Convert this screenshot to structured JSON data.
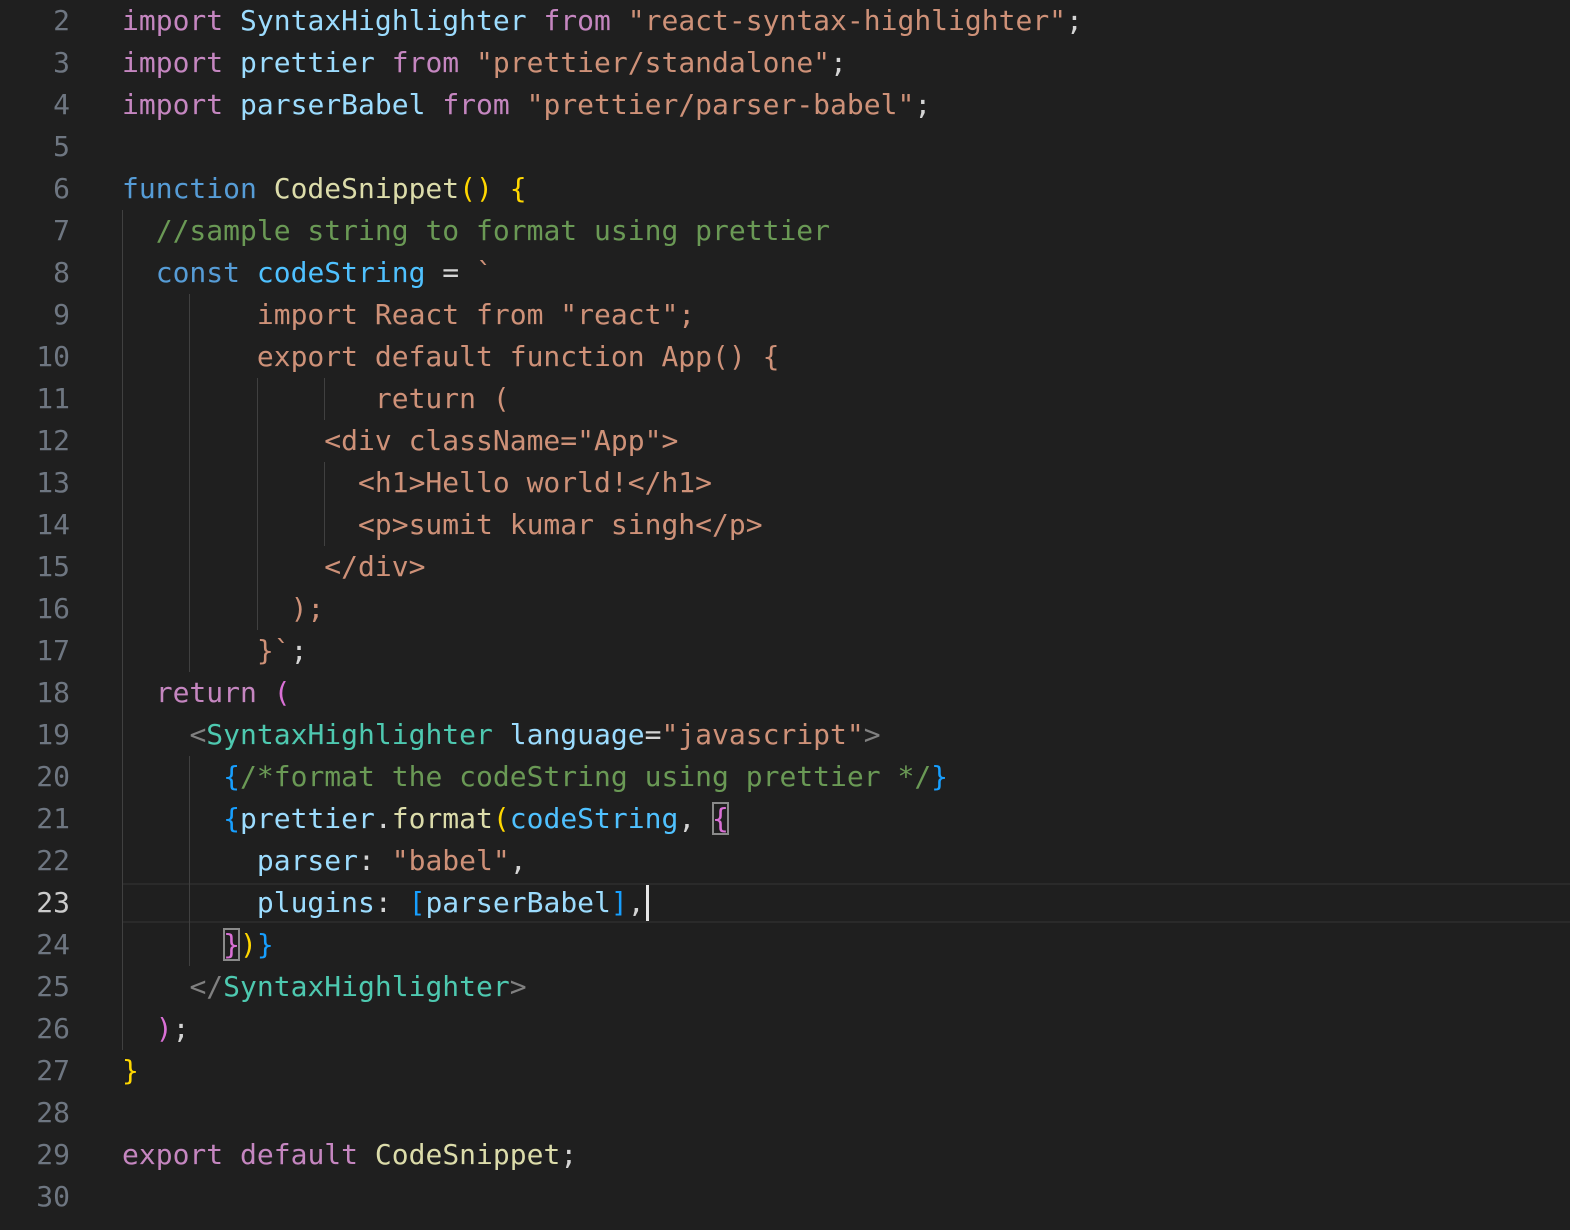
{
  "editor": {
    "language": "javascript",
    "current_line": 23,
    "colors": {
      "background": "#1f1f1f",
      "keyword_control": "#c586c0",
      "keyword_storage": "#569cd6",
      "variable": "#9cdcfe",
      "function": "#dcdcaa",
      "string": "#ce9178",
      "comment": "#6a9955",
      "component": "#4ec9b0",
      "punctuation": "#d4d4d4",
      "bracket_gold": "#ffd700",
      "bracket_pink": "#da70d6",
      "bracket_blue": "#179fff",
      "tag_bracket": "#808080",
      "line_number": "#6e7681"
    },
    "lines": [
      {
        "n": "2",
        "tokens": [
          {
            "t": "import",
            "c": "#c586c0"
          },
          {
            "t": " ",
            "c": "#d4d4d4"
          },
          {
            "t": "SyntaxHighlighter",
            "c": "#9cdcfe"
          },
          {
            "t": " ",
            "c": "#d4d4d4"
          },
          {
            "t": "from",
            "c": "#c586c0"
          },
          {
            "t": " ",
            "c": "#d4d4d4"
          },
          {
            "t": "\"react-syntax-highlighter\"",
            "c": "#ce9178"
          },
          {
            "t": ";",
            "c": "#d4d4d4"
          }
        ]
      },
      {
        "n": "3",
        "tokens": [
          {
            "t": "import",
            "c": "#c586c0"
          },
          {
            "t": " ",
            "c": "#d4d4d4"
          },
          {
            "t": "prettier",
            "c": "#9cdcfe"
          },
          {
            "t": " ",
            "c": "#d4d4d4"
          },
          {
            "t": "from",
            "c": "#c586c0"
          },
          {
            "t": " ",
            "c": "#d4d4d4"
          },
          {
            "t": "\"prettier/standalone\"",
            "c": "#ce9178"
          },
          {
            "t": ";",
            "c": "#d4d4d4"
          }
        ]
      },
      {
        "n": "4",
        "tokens": [
          {
            "t": "import",
            "c": "#c586c0"
          },
          {
            "t": " ",
            "c": "#d4d4d4"
          },
          {
            "t": "parserBabel",
            "c": "#9cdcfe"
          },
          {
            "t": " ",
            "c": "#d4d4d4"
          },
          {
            "t": "from",
            "c": "#c586c0"
          },
          {
            "t": " ",
            "c": "#d4d4d4"
          },
          {
            "t": "\"prettier/parser-babel\"",
            "c": "#ce9178"
          },
          {
            "t": ";",
            "c": "#d4d4d4"
          }
        ]
      },
      {
        "n": "5",
        "tokens": []
      },
      {
        "n": "6",
        "tokens": [
          {
            "t": "function",
            "c": "#569cd6"
          },
          {
            "t": " ",
            "c": "#d4d4d4"
          },
          {
            "t": "CodeSnippet",
            "c": "#dcdcaa"
          },
          {
            "t": "()",
            "c": "#ffd700"
          },
          {
            "t": " ",
            "c": "#d4d4d4"
          },
          {
            "t": "{",
            "c": "#ffd700"
          }
        ]
      },
      {
        "n": "7",
        "tokens": [
          {
            "t": "  ",
            "c": "#d4d4d4"
          },
          {
            "t": "//sample string to format using prettier",
            "c": "#6a9955"
          }
        ]
      },
      {
        "n": "8",
        "tokens": [
          {
            "t": "  ",
            "c": "#d4d4d4"
          },
          {
            "t": "const",
            "c": "#569cd6"
          },
          {
            "t": " ",
            "c": "#d4d4d4"
          },
          {
            "t": "codeString",
            "c": "#4fc1ff"
          },
          {
            "t": " = ",
            "c": "#d4d4d4"
          },
          {
            "t": "`",
            "c": "#ce9178"
          }
        ]
      },
      {
        "n": "9",
        "tokens": [
          {
            "t": "        import React from \"react\";",
            "c": "#ce9178"
          }
        ]
      },
      {
        "n": "10",
        "tokens": [
          {
            "t": "        export default function App() {",
            "c": "#ce9178"
          }
        ]
      },
      {
        "n": "11",
        "tokens": [
          {
            "t": "               return (",
            "c": "#ce9178"
          }
        ]
      },
      {
        "n": "12",
        "tokens": [
          {
            "t": "            <div className=\"App\">",
            "c": "#ce9178"
          }
        ]
      },
      {
        "n": "13",
        "tokens": [
          {
            "t": "              <h1>Hello world!</h1>",
            "c": "#ce9178"
          }
        ]
      },
      {
        "n": "14",
        "tokens": [
          {
            "t": "              <p>sumit kumar singh</p>",
            "c": "#ce9178"
          }
        ]
      },
      {
        "n": "15",
        "tokens": [
          {
            "t": "            </div>",
            "c": "#ce9178"
          }
        ]
      },
      {
        "n": "16",
        "tokens": [
          {
            "t": "          );",
            "c": "#ce9178"
          }
        ]
      },
      {
        "n": "17",
        "tokens": [
          {
            "t": "        }`",
            "c": "#ce9178"
          },
          {
            "t": ";",
            "c": "#d4d4d4"
          }
        ]
      },
      {
        "n": "18",
        "tokens": [
          {
            "t": "  ",
            "c": "#d4d4d4"
          },
          {
            "t": "return",
            "c": "#c586c0"
          },
          {
            "t": " ",
            "c": "#d4d4d4"
          },
          {
            "t": "(",
            "c": "#da70d6"
          }
        ]
      },
      {
        "n": "19",
        "tokens": [
          {
            "t": "    ",
            "c": "#d4d4d4"
          },
          {
            "t": "<",
            "c": "#808080"
          },
          {
            "t": "SyntaxHighlighter",
            "c": "#4ec9b0"
          },
          {
            "t": " ",
            "c": "#d4d4d4"
          },
          {
            "t": "language",
            "c": "#9cdcfe"
          },
          {
            "t": "=",
            "c": "#d4d4d4"
          },
          {
            "t": "\"javascript\"",
            "c": "#ce9178"
          },
          {
            "t": ">",
            "c": "#808080"
          }
        ]
      },
      {
        "n": "20",
        "tokens": [
          {
            "t": "      ",
            "c": "#d4d4d4"
          },
          {
            "t": "{",
            "c": "#179fff"
          },
          {
            "t": "/*format the codeString using prettier */",
            "c": "#6a9955"
          },
          {
            "t": "}",
            "c": "#179fff"
          }
        ]
      },
      {
        "n": "21",
        "tokens": [
          {
            "t": "      ",
            "c": "#d4d4d4"
          },
          {
            "t": "{",
            "c": "#179fff"
          },
          {
            "t": "prettier",
            "c": "#9cdcfe"
          },
          {
            "t": ".",
            "c": "#d4d4d4"
          },
          {
            "t": "format",
            "c": "#dcdcaa"
          },
          {
            "t": "(",
            "c": "#ffd700"
          },
          {
            "t": "codeString",
            "c": "#4fc1ff"
          },
          {
            "t": ", ",
            "c": "#d4d4d4"
          },
          {
            "t": "{",
            "c": "#da70d6",
            "box": true
          }
        ]
      },
      {
        "n": "22",
        "tokens": [
          {
            "t": "        ",
            "c": "#d4d4d4"
          },
          {
            "t": "parser",
            "c": "#9cdcfe"
          },
          {
            "t": ": ",
            "c": "#d4d4d4"
          },
          {
            "t": "\"babel\"",
            "c": "#ce9178"
          },
          {
            "t": ",",
            "c": "#d4d4d4"
          }
        ]
      },
      {
        "n": "23",
        "tokens": [
          {
            "t": "        ",
            "c": "#d4d4d4"
          },
          {
            "t": "plugins",
            "c": "#9cdcfe"
          },
          {
            "t": ": ",
            "c": "#d4d4d4"
          },
          {
            "t": "[",
            "c": "#179fff"
          },
          {
            "t": "parserBabel",
            "c": "#9cdcfe"
          },
          {
            "t": "]",
            "c": "#179fff"
          },
          {
            "t": ",",
            "c": "#d4d4d4"
          }
        ]
      },
      {
        "n": "24",
        "tokens": [
          {
            "t": "      ",
            "c": "#d4d4d4"
          },
          {
            "t": "}",
            "c": "#da70d6",
            "box": true
          },
          {
            "t": ")",
            "c": "#ffd700"
          },
          {
            "t": "}",
            "c": "#179fff"
          }
        ]
      },
      {
        "n": "25",
        "tokens": [
          {
            "t": "    ",
            "c": "#d4d4d4"
          },
          {
            "t": "</",
            "c": "#808080"
          },
          {
            "t": "SyntaxHighlighter",
            "c": "#4ec9b0"
          },
          {
            "t": ">",
            "c": "#808080"
          }
        ]
      },
      {
        "n": "26",
        "tokens": [
          {
            "t": "  ",
            "c": "#d4d4d4"
          },
          {
            "t": ")",
            "c": "#da70d6"
          },
          {
            "t": ";",
            "c": "#d4d4d4"
          }
        ]
      },
      {
        "n": "27",
        "tokens": [
          {
            "t": "}",
            "c": "#ffd700"
          }
        ]
      },
      {
        "n": "28",
        "tokens": []
      },
      {
        "n": "29",
        "tokens": [
          {
            "t": "export",
            "c": "#c586c0"
          },
          {
            "t": " ",
            "c": "#d4d4d4"
          },
          {
            "t": "default",
            "c": "#c586c0"
          },
          {
            "t": " ",
            "c": "#d4d4d4"
          },
          {
            "t": "CodeSnippet",
            "c": "#dcdcaa"
          },
          {
            "t": ";",
            "c": "#d4d4d4"
          }
        ]
      },
      {
        "n": "30",
        "tokens": []
      }
    ]
  }
}
